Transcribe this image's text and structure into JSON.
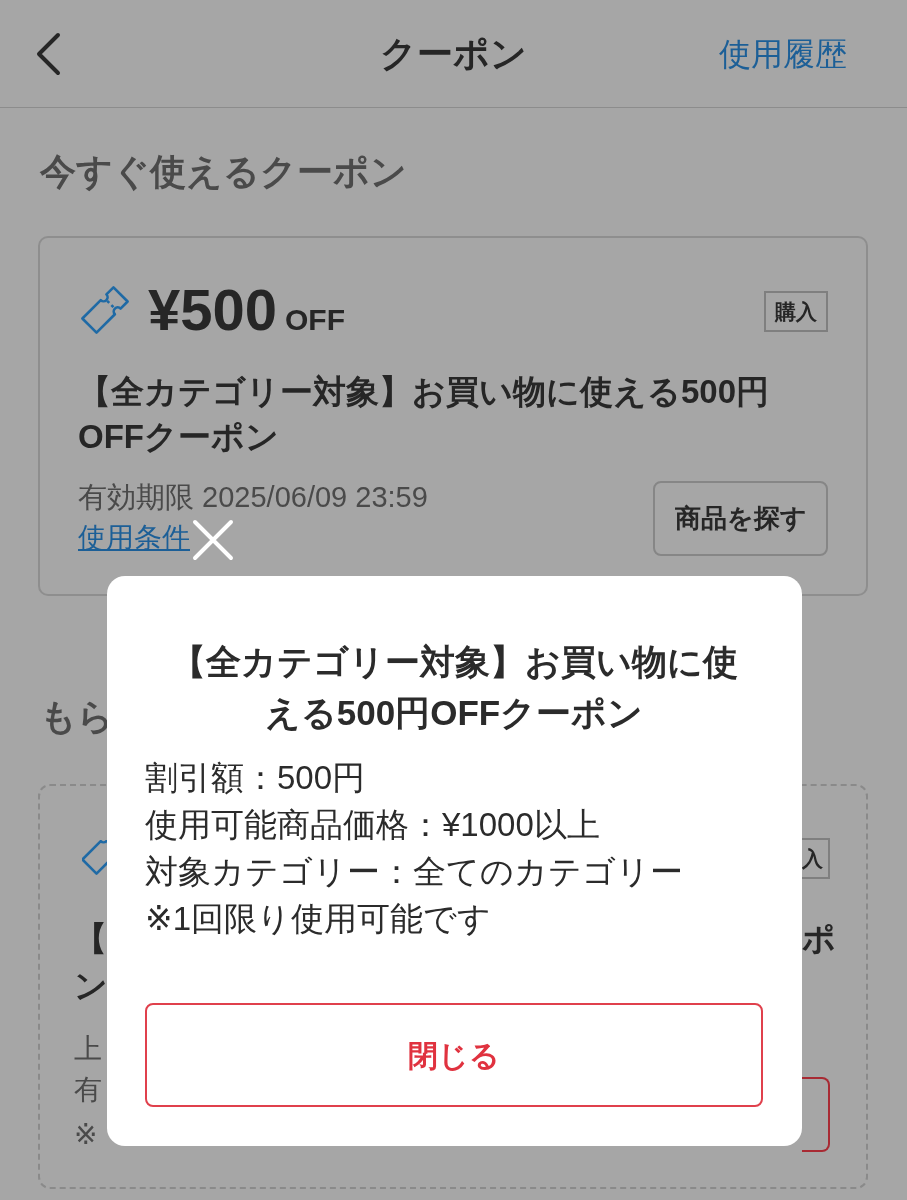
{
  "header": {
    "title": "クーポン",
    "history_link": "使用履歴"
  },
  "available_section": {
    "heading": "今すぐ使えるクーポン",
    "coupon": {
      "amount": "¥500",
      "amount_suffix": "OFF",
      "tag": "購入",
      "title": "【全カテゴリー対象】お買い物に使える500円OFFクーポン",
      "expiry": "有効期限 2025/06/09 23:59",
      "terms_link": "使用条件",
      "button": "商品を探す"
    }
  },
  "second_section": {
    "heading": "もら",
    "coupon": {
      "tag": "入",
      "title_lines": [
        {
          "left": "【",
          "right": "ポ"
        },
        {
          "left": "ン"
        }
      ],
      "detail_lines": [
        "上",
        "有",
        "※"
      ]
    }
  },
  "modal": {
    "title": "【全カテゴリー対象】お買い物に使える500円OFFクーポン",
    "details": [
      "割引額：500円",
      "使用可能商品価格：¥1000以上",
      "対象カテゴリー：全てのカテゴリー",
      "※1回限り使用可能です"
    ],
    "close_button": "閉じる"
  }
}
